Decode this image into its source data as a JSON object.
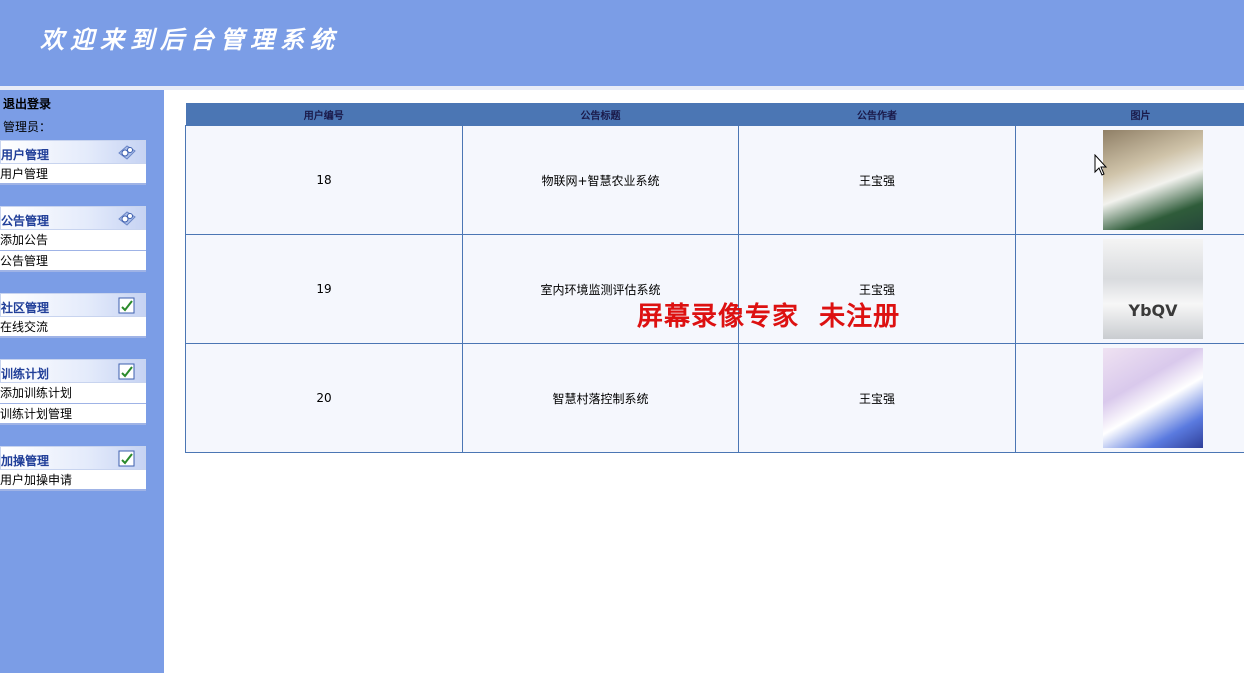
{
  "header": {
    "title": "欢迎来到后台管理系统"
  },
  "sidebar": {
    "logout": "退出登录",
    "admin_label": "管理员：",
    "groups": [
      {
        "title": "用户管理",
        "items": [
          "用户管理"
        ]
      },
      {
        "title": "公告管理",
        "items": [
          "添加公告",
          "公告管理"
        ]
      },
      {
        "title": "社区管理",
        "items": [
          "在线交流"
        ]
      },
      {
        "title": "训练计划",
        "items": [
          "添加训练计划",
          "训练计划管理"
        ]
      },
      {
        "title": "加操管理",
        "items": [
          "用户加操申请"
        ]
      }
    ]
  },
  "table": {
    "headers": [
      "用户编号",
      "公告标题",
      "公告作者",
      "图片"
    ],
    "rows": [
      {
        "id": "18",
        "title": "物联网+智慧农业系统",
        "author": "王宝强"
      },
      {
        "id": "19",
        "title": "室内环境监测评估系统",
        "author": "王宝强",
        "image_text": "YbQV"
      },
      {
        "id": "20",
        "title": "智慧村落控制系统",
        "author": "王宝强"
      }
    ]
  },
  "watermark": "屏幕录像专家  未注册",
  "colors": {
    "header_bg": "#7b9de6",
    "table_header": "#4b76b4",
    "cell_bg": "#f5f7fd",
    "watermark": "#dd1111"
  }
}
